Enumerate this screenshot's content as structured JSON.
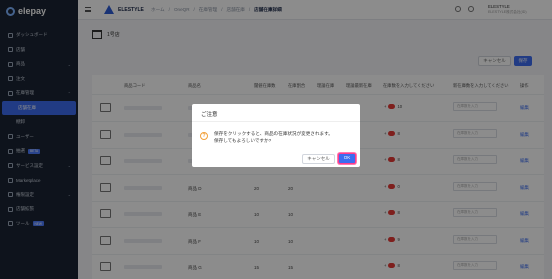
{
  "app": {
    "logo_text": "elepay"
  },
  "sidebar": {
    "items": [
      {
        "label": "ダッシュボード",
        "icon": "dashboard-icon"
      },
      {
        "label": "店舗",
        "icon": "store-icon"
      },
      {
        "label": "商品",
        "icon": "tag-icon",
        "chevron": "⌄"
      },
      {
        "label": "注文",
        "icon": "cart-icon"
      },
      {
        "label": "在庫管理",
        "icon": "box-icon",
        "chevron": "⌃"
      },
      {
        "label": "店舗在庫",
        "sub": true,
        "active": true
      },
      {
        "label": "棚卸",
        "sub": true
      },
      {
        "label": "ユーザー",
        "icon": "user-icon"
      },
      {
        "label": "抽選",
        "icon": "gift-icon",
        "tag": "BETA"
      },
      {
        "label": "サービス設定",
        "icon": "gear-icon",
        "chevron": "⌄"
      },
      {
        "label": "Marketplace",
        "icon": "market-icon"
      },
      {
        "label": "権限設定",
        "icon": "lock-icon",
        "chevron": "⌄"
      },
      {
        "label": "店舗拡張",
        "icon": "plug-icon"
      },
      {
        "label": "ツール",
        "icon": "tool-icon",
        "tag": "NEW"
      }
    ]
  },
  "topbar": {
    "brand": "ELESTYLE",
    "breadcrumbs": [
      "ホーム",
      "OneQR",
      "在庫管理",
      "店舗在庫",
      "店舗在庫詳細"
    ],
    "user_name": "ELESTYLE",
    "user_sub": "ELESTYLE株式会社(ID)"
  },
  "store": {
    "name": "1号店"
  },
  "actions": {
    "cancel": "キャンセル",
    "save": "保存"
  },
  "table": {
    "headers": [
      "商品コード",
      "商品名",
      "閾値在庫数",
      "在庫割合",
      "理論在庫",
      "理論最新在庫",
      "在庫数を入力してください",
      "新在庫数を入力してください",
      "操作"
    ],
    "rows": [
      {
        "name": "",
        "threshold": "",
        "ratio": "",
        "theory": "",
        "stock": "10",
        "edit": "編集"
      },
      {
        "name": "",
        "threshold": "",
        "ratio": "",
        "theory": "",
        "stock": "8",
        "edit": "編集"
      },
      {
        "name": "",
        "threshold": "",
        "ratio": "",
        "theory": "",
        "stock": "8",
        "edit": "編集"
      },
      {
        "name": "商品 D",
        "threshold": "20",
        "ratio": "20",
        "theory": "",
        "stock": "0",
        "edit": "編集"
      },
      {
        "name": "商品 E",
        "threshold": "10",
        "ratio": "10",
        "theory": "",
        "stock": "8",
        "edit": "編集"
      },
      {
        "name": "商品 F",
        "threshold": "10",
        "ratio": "10",
        "theory": "",
        "stock": "9",
        "edit": "編集"
      },
      {
        "name": "商品 G",
        "threshold": "15",
        "ratio": "15",
        "theory": "",
        "stock": "8",
        "edit": "編集"
      }
    ],
    "input_placeholder": "在庫数を入力"
  },
  "dialog": {
    "title": "ご注意",
    "message_line1": "保存をクリックすると、商品の在庫状況が変更されます。",
    "message_line2": "保存してもよろしいですか?",
    "cancel": "キャンセル",
    "ok": "OK"
  }
}
